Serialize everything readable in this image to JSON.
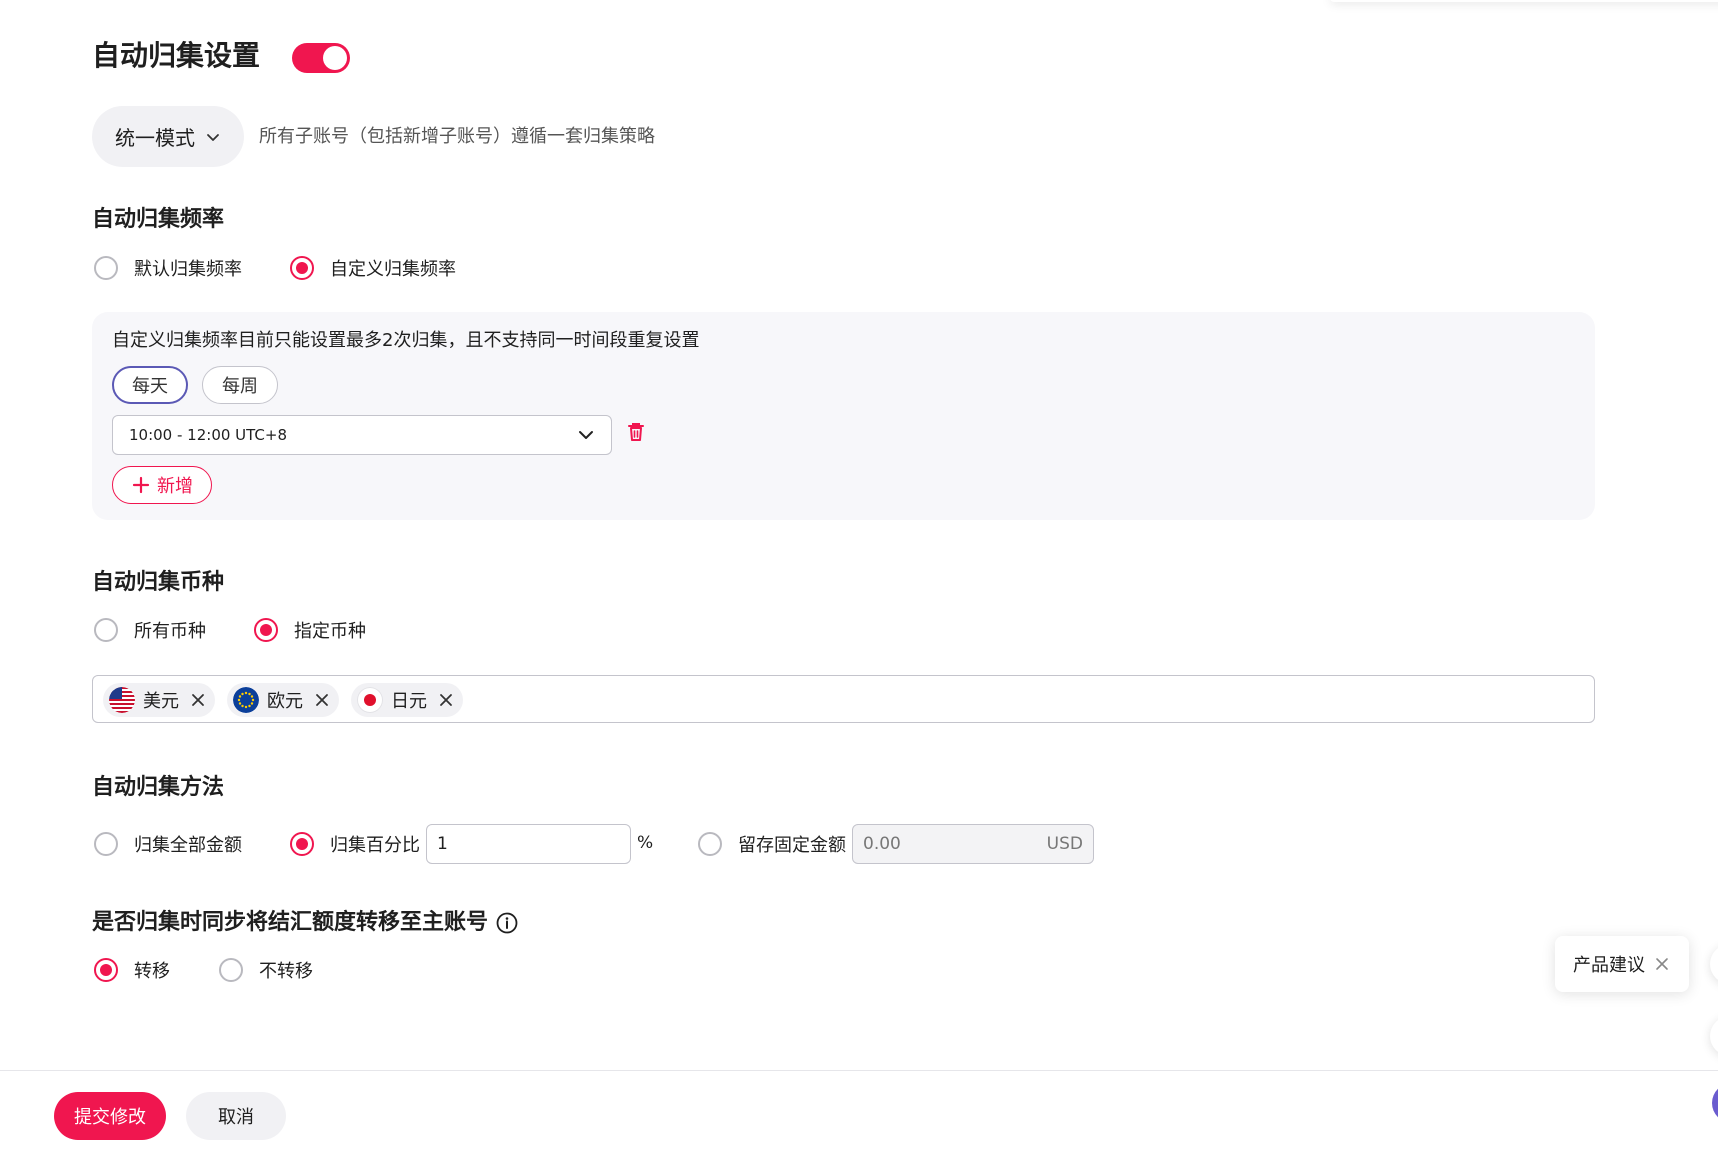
{
  "header": {
    "title": "自动归集设置",
    "toggle_on": true
  },
  "mode": {
    "label": "统一模式",
    "description": "所有子账号（包括新增子账号）遵循一套归集策略"
  },
  "frequency": {
    "title": "自动归集频率",
    "options": [
      {
        "label": "默认归集频率",
        "selected": false
      },
      {
        "label": "自定义归集频率",
        "selected": true
      }
    ],
    "note": "自定义归集频率目前只能设置最多2次归集，且不支持同一时间段重复设置",
    "periods": [
      {
        "label": "每天",
        "active": true
      },
      {
        "label": "每周",
        "active": false
      }
    ],
    "time_value": "10:00 - 12:00 UTC+8",
    "add_label": "新增"
  },
  "currency": {
    "title": "自动归集币种",
    "options": [
      {
        "label": "所有币种",
        "selected": false
      },
      {
        "label": "指定币种",
        "selected": true
      }
    ],
    "tags": [
      {
        "label": "美元",
        "flag": "us-flag-icon"
      },
      {
        "label": "欧元",
        "flag": "eu-flag-icon"
      },
      {
        "label": "日元",
        "flag": "jp-flag-icon"
      }
    ]
  },
  "method": {
    "title": "自动归集方法",
    "options": [
      {
        "label": "归集全部金额",
        "selected": false
      },
      {
        "label": "归集百分比",
        "selected": true
      },
      {
        "label": "留存固定金额",
        "selected": false
      }
    ],
    "percent_value": "1",
    "percent_unit": "%",
    "fixed_placeholder": "0.00",
    "fixed_unit": "USD"
  },
  "transfer": {
    "title": "是否归集时同步将结汇额度转移至主账号",
    "options": [
      {
        "label": "转移",
        "selected": true
      },
      {
        "label": "不转移",
        "selected": false
      }
    ]
  },
  "footer": {
    "submit_label": "提交修改",
    "cancel_label": "取消"
  },
  "feedback": {
    "label": "产品建议"
  },
  "colors": {
    "accent": "#f0164f",
    "active_outline": "#5b59b5"
  }
}
